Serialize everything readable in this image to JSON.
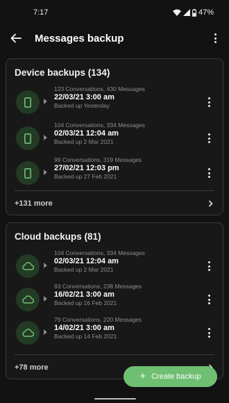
{
  "status_bar": {
    "time": "7:17",
    "battery": "47%"
  },
  "app_bar": {
    "title": "Messages backup"
  },
  "device_backups": {
    "title": "Device backups (134)",
    "items": [
      {
        "summary": "123 Conversations, 430 Messages",
        "date": "22/03/21 3:00 am",
        "backed_up": "Backed up Yesterday",
        "icon": "phone-icon"
      },
      {
        "summary": "104 Conversations, 334 Messages",
        "date": "02/03/21 12:04 am",
        "backed_up": "Backed up 2 Mar 2021",
        "icon": "phone-icon"
      },
      {
        "summary": "99 Conversations, 319 Messages",
        "date": "27/02/21 12:03 pm",
        "backed_up": "Backed up 27 Feb 2021",
        "icon": "phone-icon"
      }
    ],
    "more": "+131 more"
  },
  "cloud_backups": {
    "title": "Cloud backups (81)",
    "items": [
      {
        "summary": "104 Conversations, 334 Messages",
        "date": "02/03/21 12:04 am",
        "backed_up": "Backed up 2 Mar 2021",
        "icon": "cloud-icon"
      },
      {
        "summary": "83 Conversations, 238 Messages",
        "date": "16/02/21 3:00 am",
        "backed_up": "Backed up 16 Feb 2021",
        "icon": "cloud-icon"
      },
      {
        "summary": "79 Conversations, 220 Messages",
        "date": "14/02/21 3:00 am",
        "backed_up": "Backed up 14 Feb 2021",
        "icon": "cloud-icon"
      }
    ],
    "more": "+78 more"
  },
  "fab": {
    "label": "Create backup"
  },
  "colors": {
    "background": "#121212",
    "card": "#181818",
    "accent": "#6fbf73",
    "icon_bg": "#233a24"
  }
}
